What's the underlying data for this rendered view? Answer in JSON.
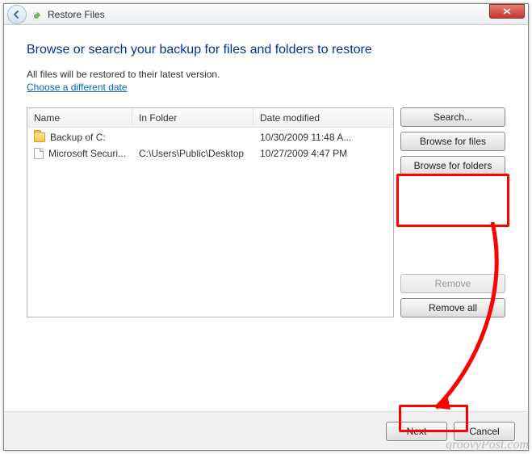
{
  "titlebar": {
    "title": "Restore Files"
  },
  "heading": "Browse or search your backup for files and folders to restore",
  "subtext": "All files will be restored to their latest version.",
  "link_text": "Choose a different date",
  "columns": {
    "name": "Name",
    "folder": "In Folder",
    "date": "Date modified"
  },
  "rows": [
    {
      "icon": "folder",
      "name": "Backup of C:",
      "folder": "",
      "date": "10/30/2009 11:48 A..."
    },
    {
      "icon": "file",
      "name": "Microsoft Securi...",
      "folder": "C:\\Users\\Public\\Desktop",
      "date": "10/27/2009 4:47 PM"
    }
  ],
  "buttons": {
    "search": "Search...",
    "browse_files": "Browse for files",
    "browse_folders": "Browse for folders",
    "remove": "Remove",
    "remove_all": "Remove all",
    "next": "Next",
    "cancel": "Cancel"
  },
  "watermark": "groovyPost.com"
}
